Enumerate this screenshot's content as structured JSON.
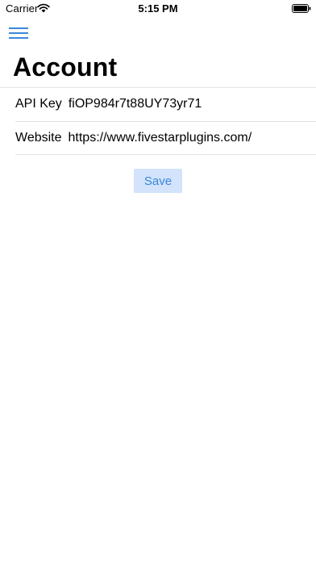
{
  "status_bar": {
    "carrier": "Carrier",
    "time": "5:15 PM",
    "wifi_icon": "wifi-icon",
    "battery_icon": "battery-icon"
  },
  "nav": {
    "menu_icon": "hamburger-menu-icon",
    "accent_color": "#3a87d9"
  },
  "page": {
    "title": "Account"
  },
  "form": {
    "api_key_label": "API Key",
    "api_key_value": "fiOP984r7t88UY73yr71",
    "website_label": "Website",
    "website_value": "https://www.fivestarplugins.com/"
  },
  "actions": {
    "save_label": "Save",
    "save_bg_color": "#d2e3fb",
    "save_text_color": "#3a87d9"
  }
}
